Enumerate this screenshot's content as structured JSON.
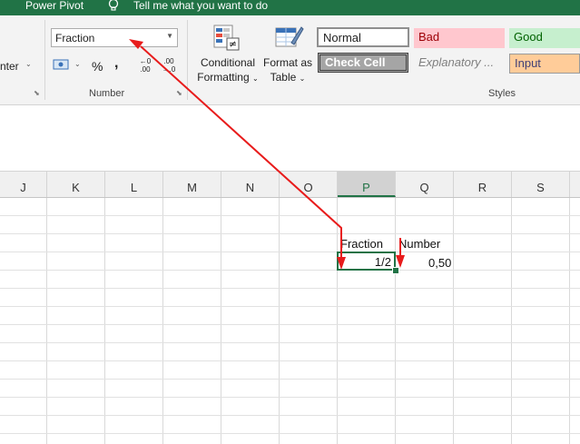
{
  "tabs": {
    "power_pivot": "Power Pivot",
    "tell_me": "Tell me what you want to do"
  },
  "ribbon": {
    "partial_label": "nter",
    "number_format": "Fraction",
    "percent": "%",
    "comma": ",",
    "number_group": "Number",
    "conditional_formatting": [
      "Conditional",
      "Formatting"
    ],
    "format_as_table": [
      "Format as",
      "Table"
    ],
    "styles_group": "Styles",
    "styles": {
      "normal": "Normal",
      "bad": "Bad",
      "good": "Good",
      "check_cell": "Check Cell",
      "explanatory": "Explanatory ...",
      "input": "Input"
    },
    "inc_decimal": [
      "←0",
      ".00"
    ],
    "dec_decimal": [
      ".00",
      "→.0"
    ]
  },
  "grid": {
    "columns": [
      "J",
      "K",
      "L",
      "M",
      "N",
      "O",
      "P",
      "Q",
      "R",
      "S"
    ],
    "selected_column": "P",
    "cells": {
      "p_header": "Fraction",
      "q_header": "Number",
      "p_value": "1/2",
      "q_value": "0,50"
    }
  },
  "colors": {
    "brand": "#217346",
    "annotation": "#e81c1c",
    "bad_bg": "#ffc7ce",
    "bad_fg": "#9c0006",
    "good_bg": "#c6efce",
    "good_fg": "#006100",
    "input_bg": "#ffcc99",
    "input_fg": "#3f3f76",
    "check_bg": "#a5a5a5"
  }
}
